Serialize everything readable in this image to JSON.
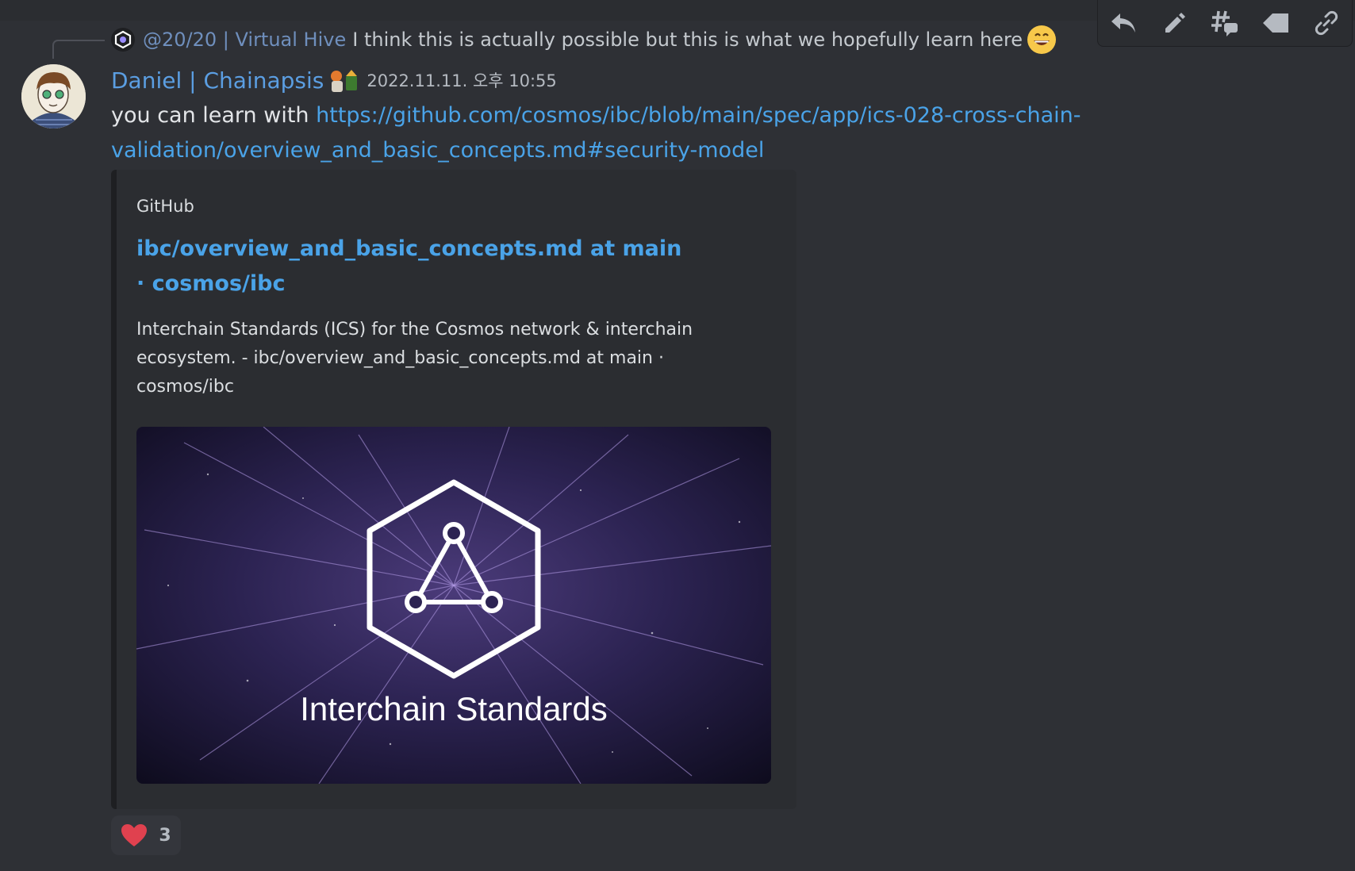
{
  "reply": {
    "author": "@20/20 | Virtual Hive",
    "text": "I think this is actually possible but this is what we hopefully learn here",
    "emoji": "grinning-emoji"
  },
  "message": {
    "author": "Daniel | Chainapsis",
    "timestamp": "2022.11.11. 오후 10:55",
    "text_prefix": "you can learn with ",
    "link": "https://github.com/cosmos/ibc/blob/main/spec/app/ics-028-cross-chain-validation/overview_and_basic_concepts.md#security-model"
  },
  "embed": {
    "provider": "GitHub",
    "title": "ibc/overview_and_basic_concepts.md at main · cosmos/ibc",
    "description": "Interchain Standards (ICS) for the Cosmos network & interchain ecosystem. - ibc/overview_and_basic_concepts.md at main · cosmos/ibc",
    "image_caption": "Interchain Standards"
  },
  "reaction": {
    "emoji": "heart-icon",
    "count": "3"
  },
  "toolbar": [
    "reply-icon",
    "edit-icon",
    "thread-icon",
    "tag-icon",
    "copy-link-icon"
  ],
  "colors": {
    "background": "#2e3035",
    "link": "#4aa3e8",
    "username": "#5b9ee2",
    "reaction_heart": "#e0414f"
  }
}
